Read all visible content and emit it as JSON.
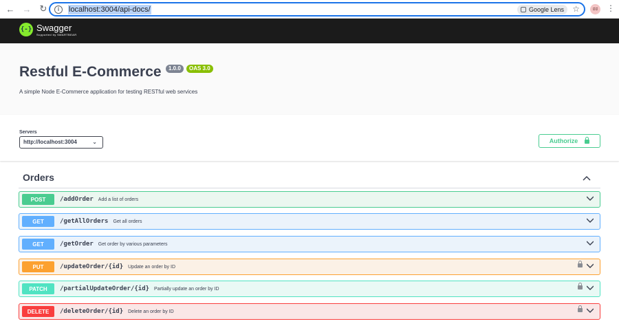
{
  "browser": {
    "url": "localhost:3004/api-docs/",
    "lens_label": "Google Lens",
    "profile_initials": "ಠಠ"
  },
  "swagger": {
    "logo_mark": "{-}",
    "logo_name": "Swagger",
    "logo_sub": "Supported by SMARTBEAR"
  },
  "info": {
    "title": "Restful E-Commerce",
    "version": "1.0.0",
    "oas": "OAS 3.0",
    "description": "A simple Node E-Commerce application for testing RESTful web services"
  },
  "servers": {
    "label": "Servers",
    "selected": "http://localhost:3004",
    "authorize_label": "Authorize"
  },
  "tag": {
    "name": "Orders"
  },
  "operations": [
    {
      "method": "POST",
      "path": "/addOrder",
      "summary": "Add a list of orders",
      "locked": false
    },
    {
      "method": "GET",
      "path": "/getAllOrders",
      "summary": "Get all orders",
      "locked": false
    },
    {
      "method": "GET",
      "path": "/getOrder",
      "summary": "Get order by various parameters",
      "locked": false
    },
    {
      "method": "PUT",
      "path": "/updateOrder/{id}",
      "summary": "Update an order by ID",
      "locked": true
    },
    {
      "method": "PATCH",
      "path": "/partialUpdateOrder/{id}",
      "summary": "Partially update an order by ID",
      "locked": true
    },
    {
      "method": "DELETE",
      "path": "/deleteOrder/{id}",
      "summary": "Delete an order by ID",
      "locked": true
    }
  ],
  "colors": {
    "post": "#49cc90",
    "get": "#61affe",
    "put": "#fca130",
    "patch": "#50e3c2",
    "delete": "#f93e3e",
    "topbar": "#1b1b1b"
  }
}
